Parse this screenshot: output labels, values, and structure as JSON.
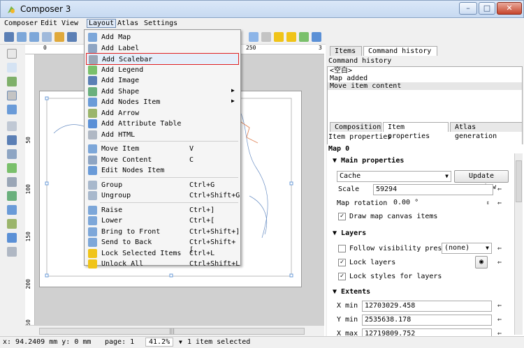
{
  "window": {
    "title": "Composer 3",
    "minimize_icon": "minimize-icon",
    "maximize_icon": "maximize-icon",
    "close_icon": "close-icon"
  },
  "menubar": {
    "composer": "Composer",
    "edit": "Edit",
    "view": "View",
    "layout": "Layout",
    "atlas": "Atlas",
    "settings": "Settings"
  },
  "toolbar": {
    "page_value": "1"
  },
  "rulers": {
    "h_ticks": [
      "0",
      "250",
      "3"
    ],
    "v_ticks": [
      "50",
      "100",
      "150",
      "200",
      "250"
    ]
  },
  "layout_menu": [
    {
      "label": "Add Map",
      "shortcut": "",
      "icon": "add-map-icon",
      "submenu": false
    },
    {
      "label": "Add Label",
      "shortcut": "",
      "icon": "add-label-icon",
      "submenu": false
    },
    {
      "label": "Add Scalebar",
      "shortcut": "",
      "icon": "add-scalebar-icon",
      "submenu": false,
      "highlight": true
    },
    {
      "label": "Add Legend",
      "shortcut": "",
      "icon": "add-legend-icon",
      "submenu": false
    },
    {
      "label": "Add Image",
      "shortcut": "",
      "icon": "add-image-icon",
      "submenu": false
    },
    {
      "label": "Add Shape",
      "shortcut": "",
      "icon": "add-shape-icon",
      "submenu": true
    },
    {
      "label": "Add Nodes Item",
      "shortcut": "",
      "icon": "add-nodes-icon",
      "submenu": true
    },
    {
      "label": "Add Arrow",
      "shortcut": "",
      "icon": "add-arrow-icon",
      "submenu": false
    },
    {
      "label": "Add Attribute Table",
      "shortcut": "",
      "icon": "add-table-icon",
      "submenu": false
    },
    {
      "label": "Add HTML",
      "shortcut": "",
      "icon": "add-html-icon",
      "submenu": false
    },
    {
      "label": "Move Item",
      "shortcut": "V",
      "icon": "move-item-icon",
      "submenu": false
    },
    {
      "label": "Move Content",
      "shortcut": "C",
      "icon": "move-content-icon",
      "submenu": false
    },
    {
      "label": "Edit Nodes Item",
      "shortcut": "",
      "icon": "edit-nodes-icon",
      "submenu": false
    },
    {
      "label": "Group",
      "shortcut": "Ctrl+G",
      "icon": "group-icon",
      "submenu": false
    },
    {
      "label": "Ungroup",
      "shortcut": "Ctrl+Shift+G",
      "icon": "ungroup-icon",
      "submenu": false
    },
    {
      "label": "Raise",
      "shortcut": "Ctrl+]",
      "icon": "raise-icon",
      "submenu": false
    },
    {
      "label": "Lower",
      "shortcut": "Ctrl+[",
      "icon": "lower-icon",
      "submenu": false
    },
    {
      "label": "Bring to Front",
      "shortcut": "Ctrl+Shift+]",
      "icon": "bring-front-icon",
      "submenu": false
    },
    {
      "label": "Send to Back",
      "shortcut": "Ctrl+Shift+[",
      "icon": "send-back-icon",
      "submenu": false
    },
    {
      "label": "Lock Selected Items",
      "shortcut": "Ctrl+L",
      "icon": "lock-icon",
      "submenu": false
    },
    {
      "label": "Unlock All",
      "shortcut": "Ctrl+Shift+L",
      "icon": "unlock-icon",
      "submenu": false
    }
  ],
  "top_panel": {
    "tabs": [
      "Items",
      "Command history"
    ],
    "header": "Command history",
    "history": [
      "<空白>",
      "Map added",
      "Move item content"
    ]
  },
  "props_panel": {
    "tabs": [
      "Composition",
      "Item properties",
      "Atlas generation"
    ],
    "header": "Item properties",
    "item_name": "Map 0",
    "main_section": "Main properties",
    "cache_value": "Cache",
    "update_preview": "Update preview",
    "scale_label": "Scale",
    "scale_value": "59294",
    "rotation_label": "Map rotation",
    "rotation_value": "0.00 °",
    "draw_canvas": "Draw map canvas items",
    "layers_section": "Layers",
    "follow_preset": "Follow visibility preset",
    "preset_value": "(none)",
    "lock_layers": "Lock layers",
    "lock_styles": "Lock styles for layers",
    "extents_section": "Extents",
    "xmin_label": "X min",
    "xmin_value": "12703029.458",
    "ymin_label": "Y min",
    "ymin_value": "2535638.178",
    "xmax_label": "X max",
    "xmax_value": "12719809.752"
  },
  "statusbar": {
    "coords": "x: 94.2409 mm y: 0 mm",
    "page": "page: 1",
    "zoom": "41.2%",
    "selection": "1 item selected"
  },
  "colors": {
    "accent": "#3a73c4",
    "highlight_border": "#e02020"
  }
}
